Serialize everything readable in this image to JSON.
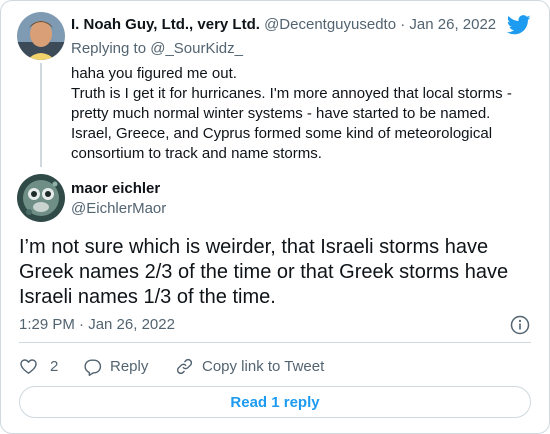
{
  "parent_tweet": {
    "name": "I. Noah Guy, Ltd., very Ltd.",
    "handle": "@Decentguyusedto",
    "separator": "·",
    "date": "Jan 26, 2022",
    "replying_prefix": "Replying to ",
    "replying_to": "@_SourKidz_",
    "lines": [
      "haha you figured me out.",
      "Truth is I get it for hurricanes. I'm more annoyed that local storms -",
      "pretty much normal winter systems - have started to be named.",
      "Israel, Greece, and Cyprus formed some kind of meteorological",
      "consortium to track and name storms."
    ]
  },
  "main_tweet": {
    "name": "maor eichler",
    "handle": "@EichlerMaor",
    "lines": [
      "I’m not sure which is weirder, that Israeli storms have",
      "Greek names 2/3 of the time or that Greek storms have",
      "Israeli names 1/3 of the time."
    ],
    "timestamp": "1:29 PM · Jan 26, 2022"
  },
  "actions": {
    "like_count": "2",
    "reply_label": "Reply",
    "copy_label": "Copy link to Tweet"
  },
  "read_replies_label": "Read 1 reply",
  "icons": {
    "brand": "twitter-bird-icon",
    "info": "info-icon",
    "like": "heart-icon",
    "reply": "reply-bubble-icon",
    "copy": "link-icon"
  },
  "colors": {
    "accent": "#1d9bf0",
    "text": "#0f1419",
    "muted": "#536471",
    "border": "#cfd9de"
  }
}
